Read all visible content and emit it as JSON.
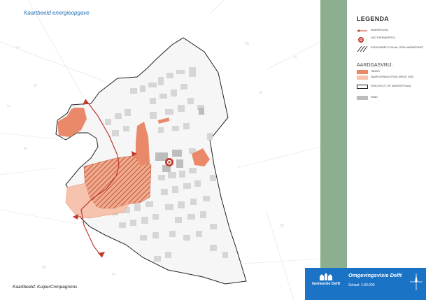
{
  "map": {
    "title": "Kaartbeeld energieopgave",
    "credit": "Kaartbeeld: KuiperCompagnons"
  },
  "legend": {
    "heading": "LEGENDA",
    "items": [
      {
        "label": "WARMTELINQ",
        "symbol": "arrow-line"
      },
      {
        "label": "GEOTHERMIEPROJ.",
        "symbol": "geothermal-icon"
      },
      {
        "label": "ZOEKGEBIED LOKAAL OPEN WARMTENET",
        "symbol": "hatch-pattern"
      }
    ],
    "subheading": "AARDGASVRIJ:",
    "gas_items": [
      {
        "label": "HUIDIG",
        "color": "#e9896a"
      },
      {
        "label": "NAAR VERWACHTING MEDIO 2030",
        "color": "#f6c4ae"
      },
      {
        "label": "NTB (VOLGT UIT WARMTEPLAN)",
        "color": "#ffffff"
      },
      {
        "label": "PAND",
        "color": "#bdbdbd"
      }
    ]
  },
  "titleblock": {
    "logo_text": "Gemeente Delft",
    "title": "Omgevingsvisie Delft",
    "scale": "Schaal: 1:30.000"
  },
  "colors": {
    "band": "#8cb08f",
    "titleblock": "#1a73c4",
    "accent": "#c0392b",
    "title_text": "#1f6fb4"
  }
}
